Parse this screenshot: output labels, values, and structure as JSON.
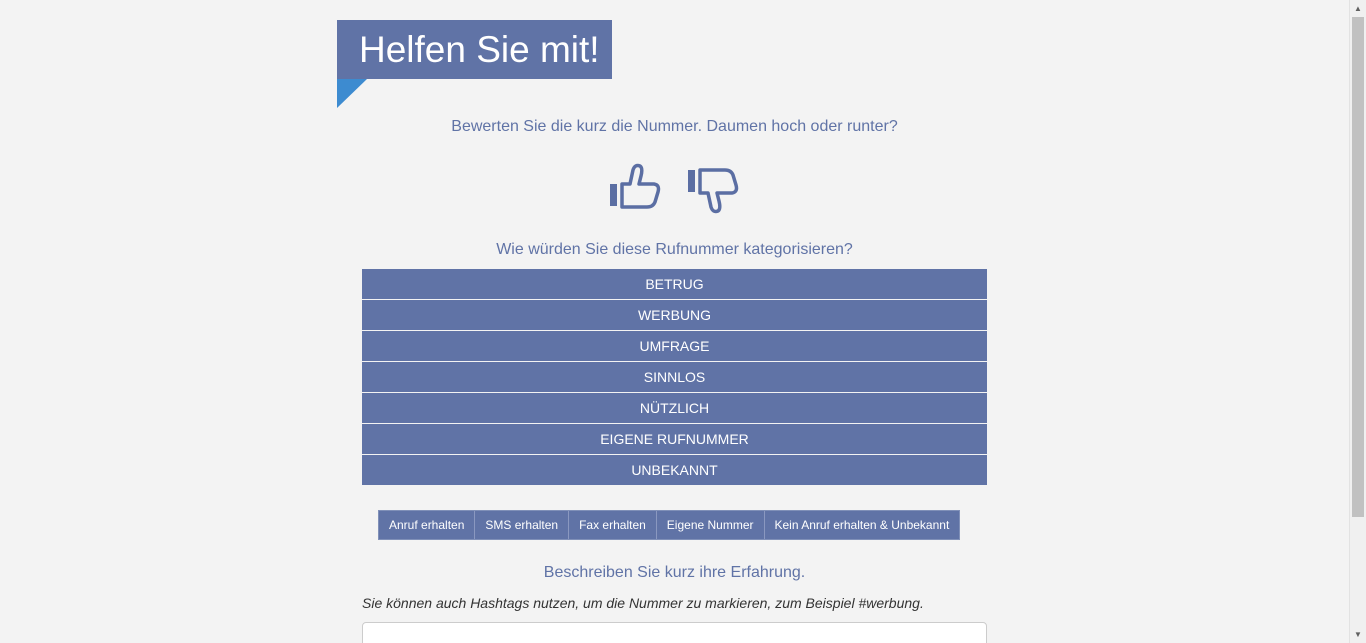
{
  "header": {
    "title": "Helfen Sie mit!"
  },
  "rating": {
    "question": "Bewerten Sie die kurz die Nummer. Daumen hoch oder runter?",
    "thumb_up_icon": "thumbs-up-icon",
    "thumb_down_icon": "thumbs-down-icon",
    "icon_color": "#5b6ea3"
  },
  "category": {
    "question": "Wie würden Sie diese Rufnummer kategorisieren?",
    "options": [
      "BETRUG",
      "WERBUNG",
      "UMFRAGE",
      "SINNLOS",
      "NÜTZLICH",
      "EIGENE RUFNUMMER",
      "UNBEKANNT"
    ]
  },
  "contact_type": {
    "tabs": [
      "Anruf erhalten",
      "SMS erhalten",
      "Fax erhalten",
      "Eigene Nummer",
      "Kein Anruf erhalten & Unbekannt"
    ]
  },
  "experience": {
    "question": "Beschreiben Sie kurz ihre Erfahrung.",
    "hint": "Sie können auch Hashtags nutzen, um die Nummer zu markieren, zum Beispiel #werbung.",
    "value": ""
  },
  "colors": {
    "accent": "#6073a6",
    "ribbon_fold": "#3d8bd0",
    "background": "#f3f3f3"
  }
}
